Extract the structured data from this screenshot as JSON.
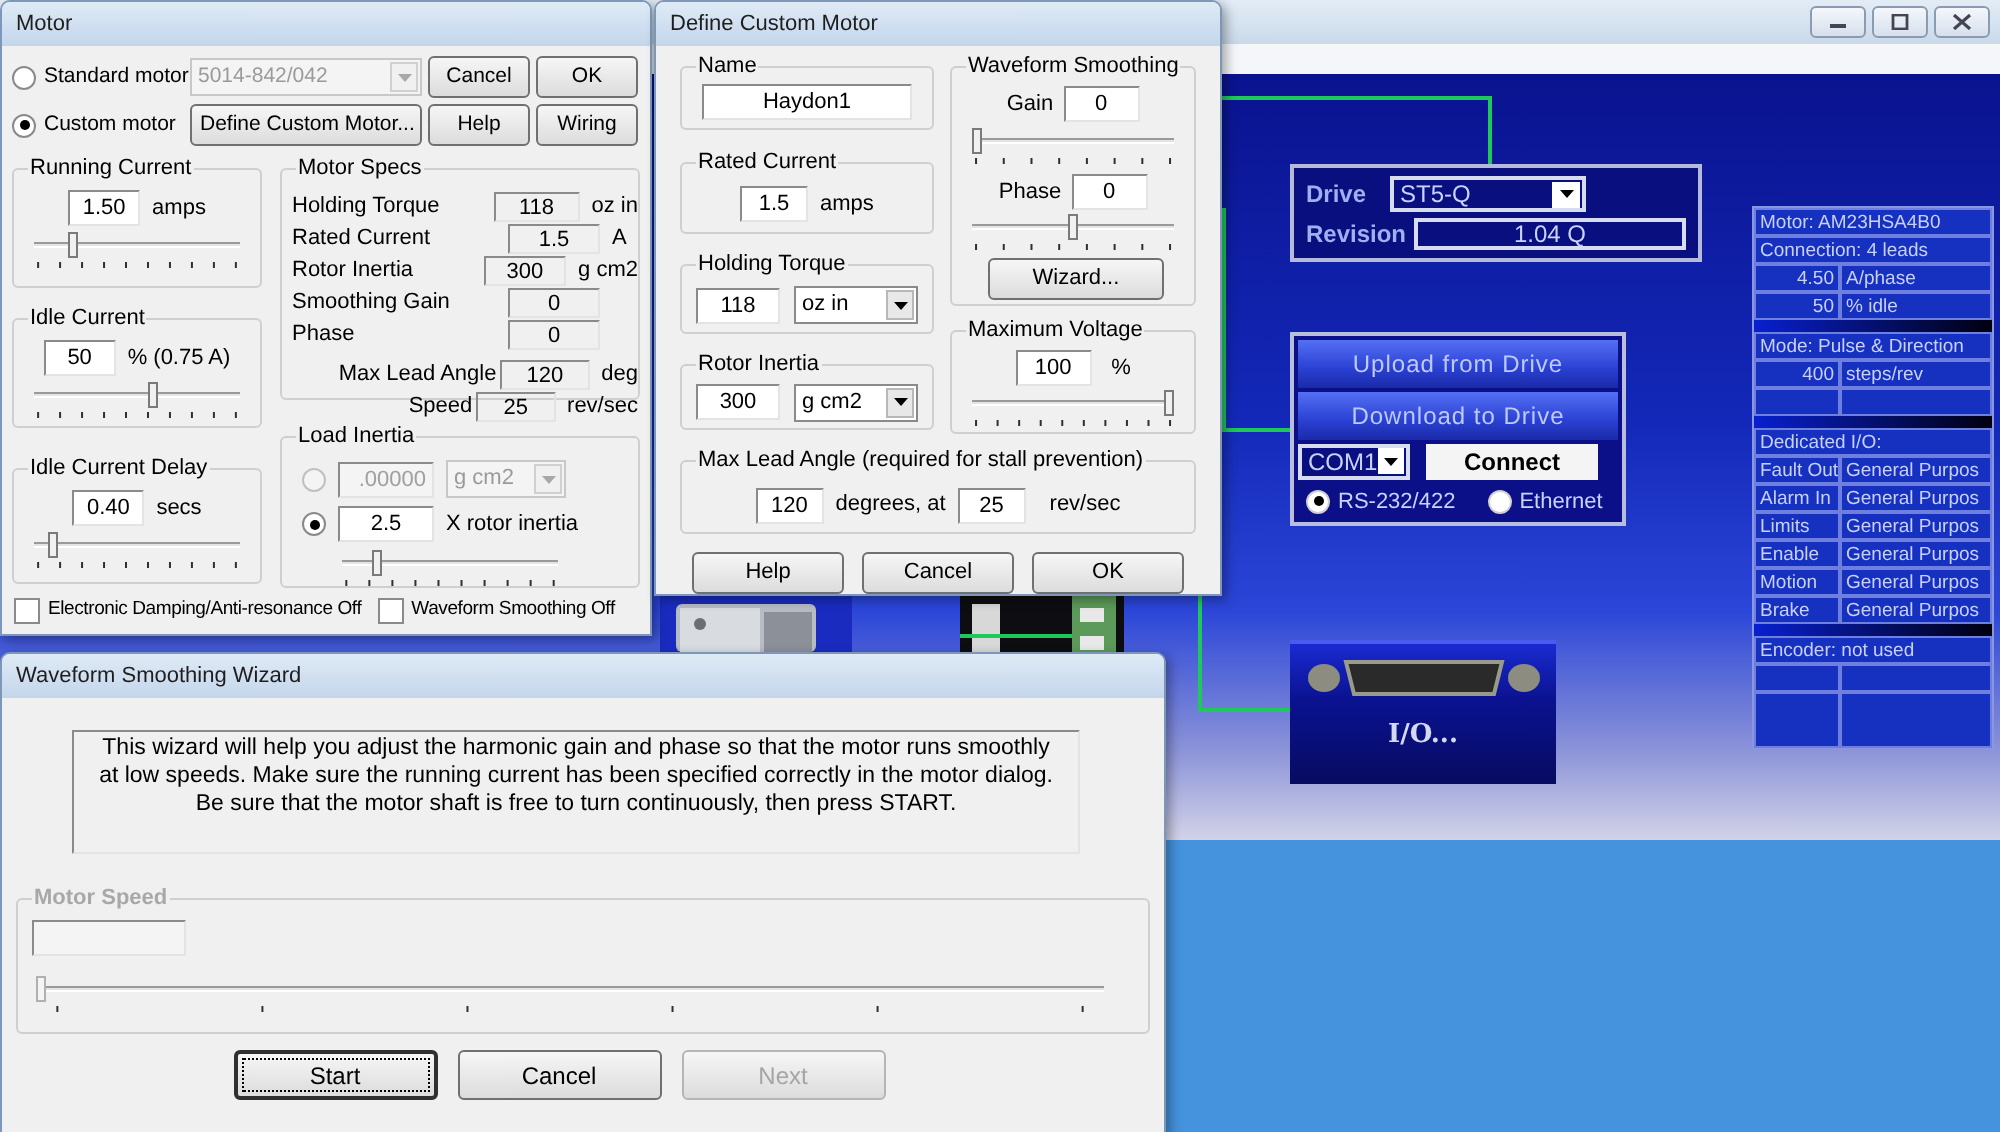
{
  "drive_panel": {
    "drive_label": "Drive",
    "drive": "ST5-Q",
    "revision_label": "Revision",
    "revision": "1.04 Q"
  },
  "connection_panel": {
    "buttons": [
      "Upload from Drive",
      "Download to Drive"
    ],
    "port": "COM1",
    "connect": "Connect",
    "protocols": [
      {
        "label": "RS-232/422",
        "selected": true
      },
      {
        "label": "Ethernet",
        "selected": false
      }
    ]
  },
  "io_button": {
    "label": "I/O..."
  },
  "summary_table": {
    "rows": [
      {
        "kind": "span",
        "text": "Motor: AM23HSA4B0"
      },
      {
        "kind": "span",
        "text": "Connection: 4 leads"
      },
      {
        "kind": "value",
        "value": "4.50",
        "unit": "A/phase"
      },
      {
        "kind": "value",
        "value": "50",
        "unit": "% idle"
      },
      {
        "kind": "divider"
      },
      {
        "kind": "span",
        "text": "Mode: Pulse & Direction"
      },
      {
        "kind": "value",
        "value": "400",
        "unit": "steps/rev"
      },
      {
        "kind": "blank"
      },
      {
        "kind": "divider"
      },
      {
        "kind": "span",
        "text": "Dedicated I/O:"
      },
      {
        "kind": "pair",
        "label": "Fault Out",
        "value": "General Purpos"
      },
      {
        "kind": "pair",
        "label": "Alarm In",
        "value": "General Purpos"
      },
      {
        "kind": "pair",
        "label": "Limits",
        "value": "General Purpos"
      },
      {
        "kind": "pair",
        "label": "Enable",
        "value": "General Purpos"
      },
      {
        "kind": "pair",
        "label": "Motion",
        "value": "General Purpos"
      },
      {
        "kind": "pair",
        "label": "Brake",
        "value": "General Purpos"
      },
      {
        "kind": "divider"
      },
      {
        "kind": "span",
        "text": "Encoder: not used"
      },
      {
        "kind": "blank"
      },
      {
        "kind": "tallblank"
      }
    ]
  },
  "motor_dialog": {
    "title": "Motor",
    "motor_types": [
      {
        "label": "Standard motor",
        "selected": false
      },
      {
        "label": "Custom motor",
        "selected": true
      }
    ],
    "standard_model": "5014-842/042",
    "define_button": "Define Custom Motor...",
    "buttons": [
      "Cancel",
      "OK",
      "Help",
      "Wiring"
    ],
    "running_current": {
      "title": "Running Current",
      "value": "1.50",
      "unit": "amps",
      "level": 0.17
    },
    "idle_current": {
      "title": "Idle Current",
      "value": "50",
      "unit": "% (0.75 A)",
      "level": 0.58
    },
    "idle_delay": {
      "title": "Idle Current Delay",
      "value": "0.40",
      "unit": "secs",
      "level": 0.07
    },
    "motor_specs": {
      "title": "Motor Specs",
      "rows": [
        {
          "label": "Holding Torque",
          "value": "118",
          "unit": "oz in"
        },
        {
          "label": "Rated Current",
          "value": "1.5",
          "unit": "A"
        },
        {
          "label": "Rotor Inertia",
          "value": "300",
          "unit": "g cm2"
        },
        {
          "label": "Smoothing Gain",
          "value": "0"
        },
        {
          "label": "Phase",
          "value": "0"
        }
      ],
      "lead_rows": [
        {
          "label": "Max Lead Angle",
          "value": "120",
          "unit": "deg"
        },
        {
          "label": "Speed",
          "value": "25",
          "unit": "rev/sec"
        }
      ]
    },
    "load_inertia": {
      "title": "Load Inertia",
      "level": 0.15,
      "options": [
        {
          "kind": "absolute",
          "value": ".00000",
          "unit": "g cm2",
          "selected": false
        },
        {
          "kind": "ratio",
          "value": "2.5",
          "unit": "X rotor inertia",
          "selected": true
        }
      ]
    },
    "checkboxes": [
      {
        "label": "Electronic Damping/Anti-resonance Off",
        "checked": false
      },
      {
        "label": "Waveform Smoothing Off",
        "checked": false
      }
    ]
  },
  "custom_motor_dialog": {
    "title": "Define Custom Motor",
    "name": {
      "title": "Name",
      "value": "Haydon1"
    },
    "rated_current": {
      "title": "Rated Current",
      "value": "1.5",
      "unit": "amps"
    },
    "holding_torque": {
      "title": "Holding Torque",
      "value": "118",
      "unit": "oz in"
    },
    "rotor_inertia": {
      "title": "Rotor Inertia",
      "value": "300",
      "unit": "g cm2"
    },
    "smoothing": {
      "title": "Waveform Smoothing",
      "gain": {
        "label": "Gain",
        "value": "0",
        "level": 0
      },
      "phase": {
        "label": "Phase",
        "value": "0",
        "level": 0.5
      },
      "wizard_button": "Wizard..."
    },
    "max_voltage": {
      "title": "Maximum Voltage",
      "value": "100",
      "unit": "%",
      "level": 1
    },
    "lead_angle": {
      "title": "Max Lead Angle (required for stall prevention)",
      "angle": "120",
      "angle_unit": "degrees, at",
      "speed": "25",
      "speed_unit": "rev/sec"
    },
    "buttons": [
      "Help",
      "Cancel",
      "OK"
    ]
  },
  "wizard": {
    "title": "Waveform Smoothing Wizard",
    "message": "This wizard will help you adjust the harmonic gain and phase so that the motor runs smoothly\nat low speeds.  Make sure the running current has been specified correctly in the motor dialog.\nBe sure that the motor shaft is free to turn continuously, then press START.",
    "speed": {
      "title": "Motor Speed",
      "disabled": true,
      "level": 0
    },
    "buttons": [
      {
        "label": "Start",
        "disabled": false,
        "focused": true
      },
      {
        "label": "Cancel",
        "disabled": false,
        "focused": false
      },
      {
        "label": "Next",
        "disabled": true,
        "focused": false
      }
    ]
  }
}
